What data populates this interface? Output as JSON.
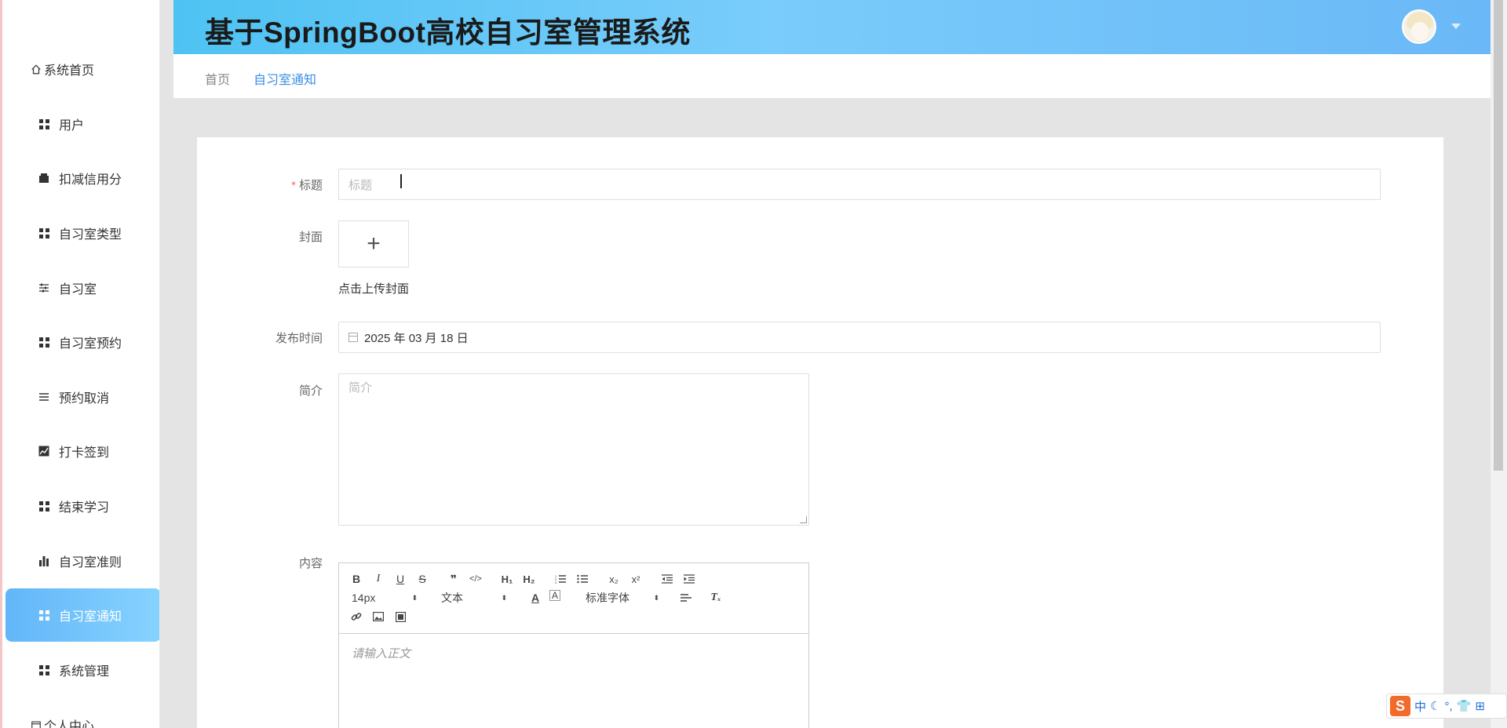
{
  "sidebar": {
    "items": [
      {
        "label": "系统首页",
        "icon": "home-icon"
      },
      {
        "label": "用户",
        "icon": "grid-icon"
      },
      {
        "label": "扣减信用分",
        "icon": "wallet-icon"
      },
      {
        "label": "自习室类型",
        "icon": "grid-icon"
      },
      {
        "label": "自习室",
        "icon": "sliders-icon"
      },
      {
        "label": "自习室预约",
        "icon": "grid-icon"
      },
      {
        "label": "预约取消",
        "icon": "list-icon"
      },
      {
        "label": "打卡签到",
        "icon": "line-chart-icon"
      },
      {
        "label": "结束学习",
        "icon": "grid-icon"
      },
      {
        "label": "自习室准则",
        "icon": "bar-chart-icon"
      },
      {
        "label": "自习室通知",
        "icon": "grid-icon",
        "active": true
      },
      {
        "label": "系统管理",
        "icon": "grid-icon"
      },
      {
        "label": "个人中心",
        "icon": "calendar-icon"
      }
    ]
  },
  "header": {
    "title": "基于SpringBoot高校自习室管理系统"
  },
  "breadcrumb": {
    "home": "首页",
    "current": "自习室通知"
  },
  "form": {
    "title_label": "标题",
    "title_placeholder": "标题",
    "cover_label": "封面",
    "cover_upload_symbol": "+",
    "cover_tip": "点击上传封面",
    "publish_time_label": "发布时间",
    "publish_time_value": "2025 年 03 月 18 日",
    "summary_label": "简介",
    "summary_placeholder": "简介",
    "content_label": "内容",
    "editor": {
      "font_size": "14px",
      "text_type": "文本",
      "font_family": "标准字体",
      "body_placeholder": "请输入正文"
    }
  },
  "ime": {
    "logo": "S",
    "mode": "中"
  },
  "colors": {
    "accent": "#3a8ee6",
    "header_gradient_start": "#4ec3f3",
    "header_gradient_end": "#6ab8f7",
    "active_item": "#62b6f8",
    "required": "#f56c6c"
  }
}
